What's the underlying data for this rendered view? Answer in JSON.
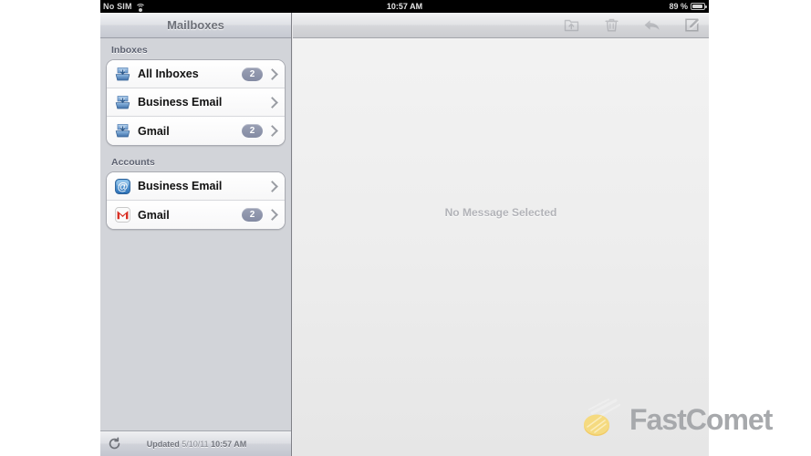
{
  "status_bar": {
    "carrier": "No SIM",
    "wifi_icon": "wifi-icon",
    "time": "10:57 AM",
    "battery_percent": "89 %",
    "battery_icon": "battery-icon"
  },
  "sidebar": {
    "title": "Mailboxes",
    "groups": [
      {
        "header": "Inboxes",
        "rows": [
          {
            "icon": "inbox-tray-icon",
            "label": "All Inboxes",
            "badge": "2",
            "chevron": "chevron-right-icon"
          },
          {
            "icon": "inbox-tray-icon",
            "label": "Business Email",
            "badge": "",
            "chevron": "chevron-right-icon"
          },
          {
            "icon": "inbox-tray-icon",
            "label": "Gmail",
            "badge": "2",
            "chevron": "chevron-right-icon"
          }
        ]
      },
      {
        "header": "Accounts",
        "rows": [
          {
            "icon": "at-sign-account-icon",
            "label": "Business Email",
            "badge": "",
            "chevron": "chevron-right-icon"
          },
          {
            "icon": "gmail-m-icon",
            "label": "Gmail",
            "badge": "2",
            "chevron": "chevron-right-icon"
          }
        ]
      }
    ],
    "toolbar": {
      "refresh_icon": "refresh-icon",
      "updated_label": "Updated",
      "updated_date": "5/10/11",
      "updated_time": "10:57 AM"
    }
  },
  "detail": {
    "toolbar": [
      {
        "name": "move-to-folder-button",
        "icon": "folder-move-icon"
      },
      {
        "name": "delete-button",
        "icon": "trash-icon"
      },
      {
        "name": "reply-button",
        "icon": "reply-arrow-icon"
      },
      {
        "name": "compose-button",
        "icon": "compose-pencil-icon"
      }
    ],
    "empty_state": "No Message Selected"
  },
  "watermark": {
    "icon": "comet-icon",
    "text": "FastComet"
  },
  "colors": {
    "badge": "#8a91a8",
    "sidebar_bg": "#d2d4d9",
    "navbar_text": "#6d7078",
    "comet_yellow": "#f5d06a",
    "watermark_gray": "#a7a9ac",
    "gmail_red": "#d93025",
    "account_blue": "#3f93d8"
  }
}
